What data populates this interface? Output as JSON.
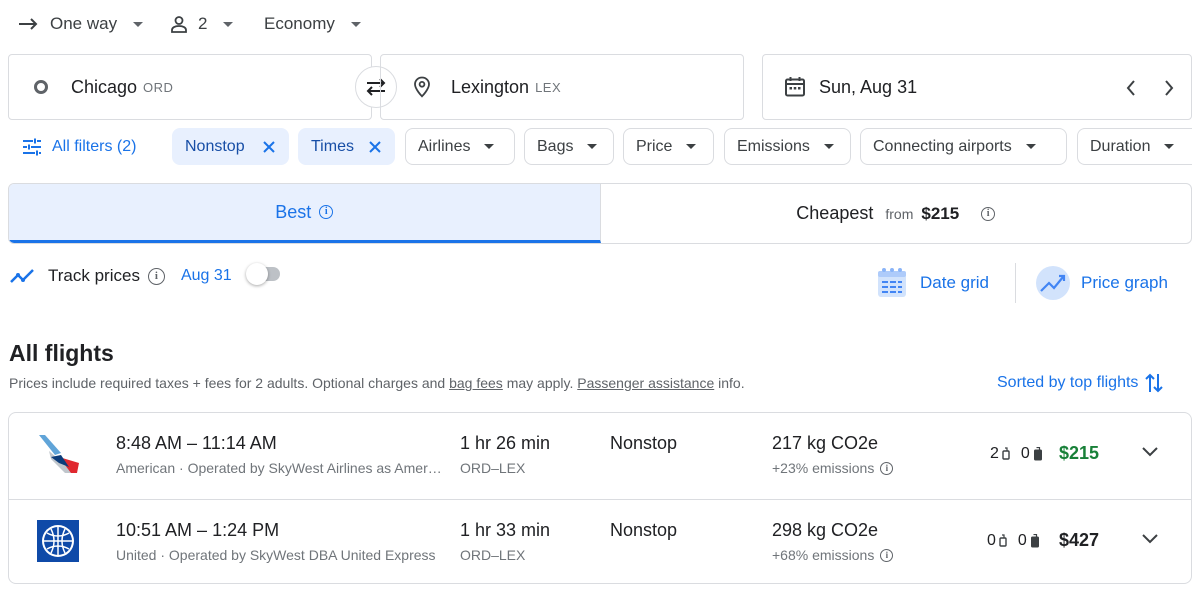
{
  "trip": {
    "type": "One way",
    "passengers": "2",
    "cabin": "Economy"
  },
  "search": {
    "origin_city": "Chicago",
    "origin_code": "ORD",
    "dest_city": "Lexington",
    "dest_code": "LEX",
    "date": "Sun, Aug 31"
  },
  "filters": {
    "all_filters": "All filters (2)",
    "chips": [
      "Nonstop",
      "Times",
      "Airlines",
      "Bags",
      "Price",
      "Emissions",
      "Connecting airports",
      "Duration"
    ]
  },
  "tabs": {
    "best": "Best",
    "cheapest": "Cheapest",
    "cheapest_from": "from",
    "cheapest_price": "$215"
  },
  "track": {
    "label": "Track prices",
    "date": "Aug 31",
    "enabled": false
  },
  "views": {
    "date_grid": "Date grid",
    "price_graph": "Price graph"
  },
  "results": {
    "heading": "All flights",
    "note_prefix": "Prices include required taxes + fees for 2 adults. Optional charges and",
    "note_link1": "bag fees",
    "note_mid": "may apply.",
    "note_link2": "Passenger assistance",
    "note_suffix": "info.",
    "sort": "Sorted by top flights"
  },
  "flights": [
    {
      "times": "8:48 AM – 11:14 AM",
      "airline": "American · Operated by SkyWest Airlines as Amer…",
      "duration": "1 hr 26 min",
      "route": "ORD–LEX",
      "stops": "Nonstop",
      "emissions": "217 kg CO2e",
      "emissions_delta": "+23% emissions",
      "carry_on": "2",
      "checked": "0",
      "price": "$215",
      "price_color": "#188038"
    },
    {
      "times": "10:51 AM – 1:24 PM",
      "airline": "United · Operated by SkyWest DBA United Express",
      "duration": "1 hr 33 min",
      "route": "ORD–LEX",
      "stops": "Nonstop",
      "emissions": "298 kg CO2e",
      "emissions_delta": "+68% emissions",
      "carry_on": "0",
      "checked": "0",
      "price": "$427",
      "price_color": "#202124"
    }
  ],
  "colors": {
    "accent": "#1a73e8",
    "active_chip_bg": "#e8f0fe",
    "good_price": "#188038"
  }
}
